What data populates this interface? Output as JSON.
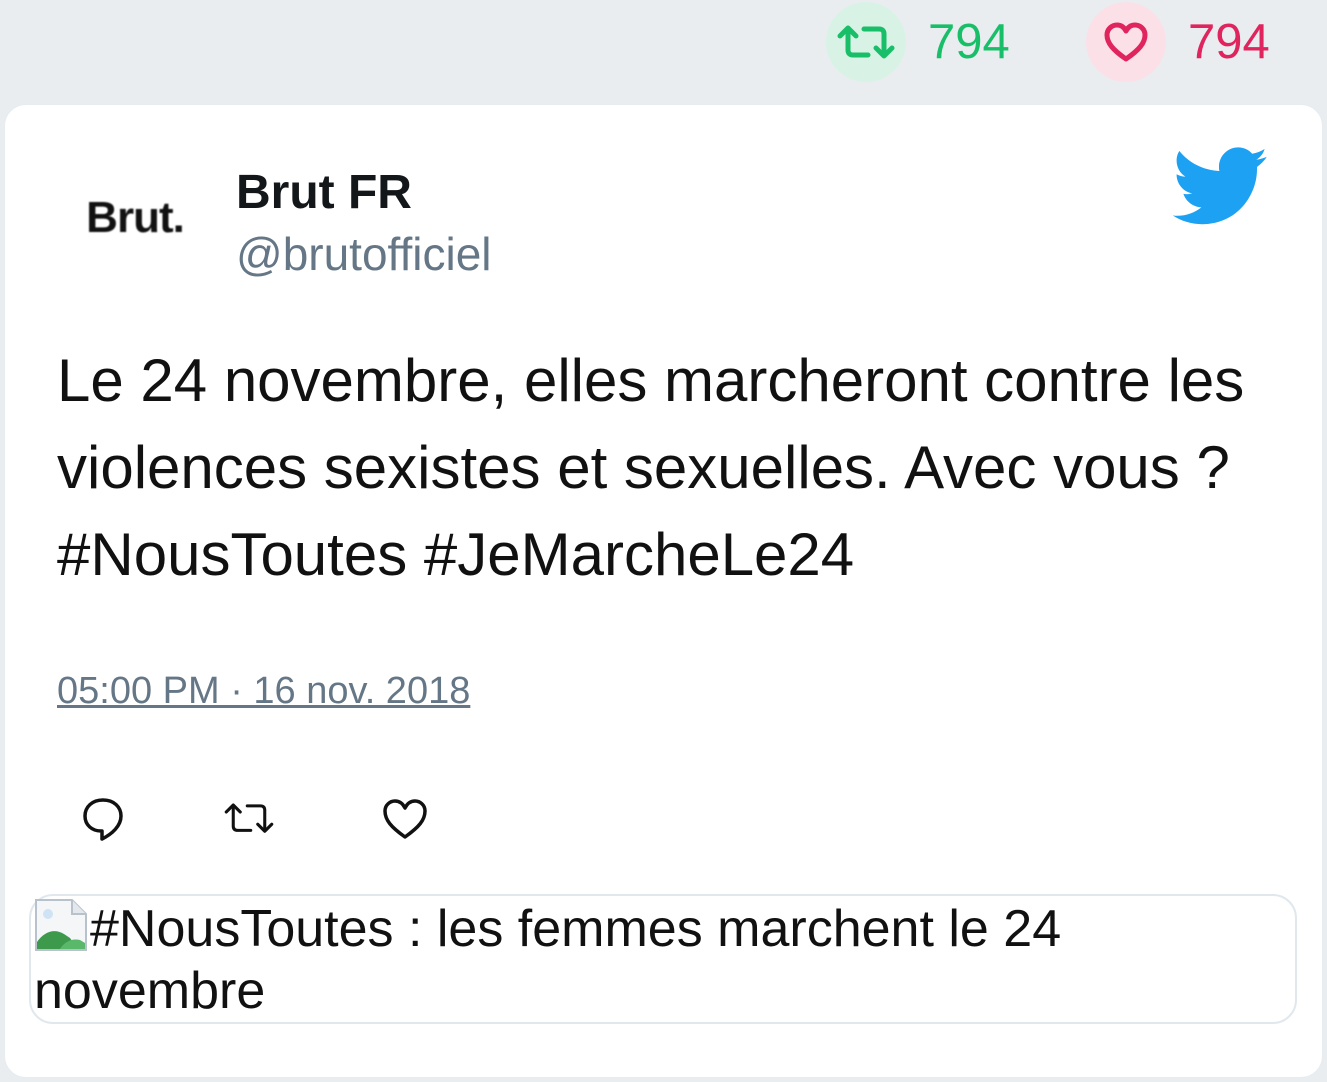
{
  "stats": {
    "retweets": "794",
    "likes": "794"
  },
  "author": {
    "avatar_text": "Brut.",
    "name": "Brut FR",
    "handle": "@brutofficiel"
  },
  "tweet": {
    "text": "Le 24 novembre, elles marcheront contre les violences sexistes et sexuelles. Avec vous ? #NousToutes #JeMarcheLe24",
    "timestamp": "05:00 PM · 16 nov. 2018"
  },
  "media": {
    "alt_text": "#NousToutes : les femmes marchent le 24 novembre"
  },
  "colors": {
    "retweet_green": "#19bf68",
    "like_red": "#e0245e",
    "twitter_blue": "#1da1f2",
    "muted_gray": "#657786"
  },
  "icons": {
    "retweet": "retweet-icon",
    "like": "heart-icon",
    "reply": "reply-icon",
    "brand": "twitter-bird-icon",
    "media": "broken-image-icon"
  }
}
